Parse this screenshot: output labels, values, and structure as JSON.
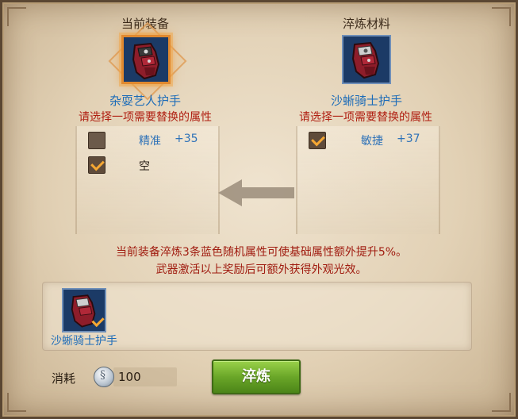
{
  "current": {
    "title": "当前装备",
    "item_name": "杂耍艺人护手",
    "hint": "请选择一项需要替换的属性",
    "attributes": [
      {
        "name": "精准",
        "value": "+35",
        "checked": false
      },
      {
        "name": "空",
        "value": "",
        "checked": true
      }
    ]
  },
  "material": {
    "title": "淬炼材料",
    "item_name": "沙蜥骑士护手",
    "hint": "请选择一项需要替换的属性",
    "attributes": [
      {
        "name": "敏捷",
        "value": "+37",
        "checked": true
      }
    ]
  },
  "info": {
    "line1": "当前装备淬炼3条蓝色随机属性可使基础属性额外提升5%。",
    "line2": "武器激活以上奖励后可额外获得外观光效。"
  },
  "selected_material": {
    "name": "沙蜥骑士护手"
  },
  "cost": {
    "label": "消耗",
    "value": "100",
    "icon": "silver-coin-icon"
  },
  "action": {
    "label": "淬炼"
  },
  "colors": {
    "accent": "#e0892f",
    "name_blue": "#1d6cb8",
    "hint_red": "#b01f12",
    "button_green": "#6aa628"
  }
}
